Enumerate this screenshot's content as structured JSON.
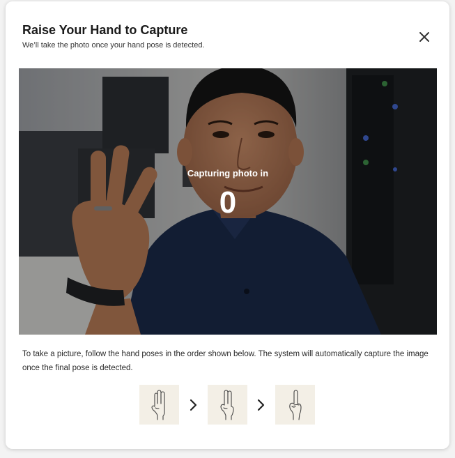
{
  "dialog": {
    "title": "Raise Your Hand to Capture",
    "subtitle": "We’ll take the photo once your hand pose is detected.",
    "close_icon": "close-icon"
  },
  "camera": {
    "countdown_label": "Capturing photo in",
    "countdown_value": "0"
  },
  "instructions": "To take a picture, follow the hand poses in the order shown below. The system will automatically capture the image once the final pose is detected.",
  "poses": [
    {
      "icon": "three-fingers-icon"
    },
    {
      "icon": "two-fingers-icon"
    },
    {
      "icon": "one-finger-icon"
    }
  ],
  "colors": {
    "tile_bg": "#f3efe6",
    "shirt": "#1b2a4a"
  }
}
